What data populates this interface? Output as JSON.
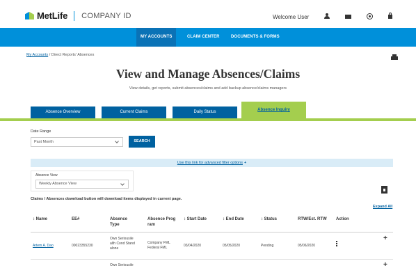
{
  "header": {
    "brand": "MetLife",
    "product": "COMPANY ID",
    "welcome": "Welcome User",
    "icons": [
      "user-icon",
      "mail-icon",
      "gear-icon",
      "lock-icon"
    ]
  },
  "nav": {
    "items": [
      {
        "label": "MY ACCOUNTS",
        "active": true
      },
      {
        "label": "CLAIM CENTER",
        "active": false
      },
      {
        "label": "DOCUMENTS & FORMS",
        "active": false
      }
    ]
  },
  "breadcrumb": {
    "root": "My Accounts",
    "rest": " / Direct Reports' Absences"
  },
  "page": {
    "title": "View and Manage Absences/Claims",
    "subtitle": "View details, get reports, submit absences/claims and add backup absence/claims managers"
  },
  "tabs": [
    {
      "label": "Absence Overview",
      "active": false
    },
    {
      "label": "Current Claims",
      "active": false
    },
    {
      "label": "Daily Status",
      "active": false
    },
    {
      "label": "Absence Inquiry",
      "active": true
    }
  ],
  "filters": {
    "date_range_label": "Date Range",
    "date_range_value": "Past Month",
    "search_label": "SEARCH",
    "advanced_link": "Use this link for advanced filter options",
    "advanced_plus": "+",
    "absence_view_label": "Absence View",
    "absence_view_value": "Weekly Absence View"
  },
  "notice": "Claims / Absences download button will download items displayed in current page.",
  "expand_all": "Expand All",
  "table": {
    "columns": [
      "↕ Name",
      "EE#",
      "Absence Type",
      "Absence Prog ram",
      "↕ Start Date",
      "↕ End Date",
      "↕ Status",
      "RTW/Est. RTW",
      "Action"
    ],
    "rows": [
      {
        "name": "Artem A. Dao",
        "ee": "00023355230",
        "type": "Own Seriousile alth Cond Stand alone",
        "program": "Company FML Federal FML",
        "start": "03/04/2020",
        "end": "05/05/2020",
        "status": "Pending",
        "rtw": "05/06/2020",
        "expand": "+"
      },
      {
        "name": "",
        "ee": "",
        "type": "Own Seriousile",
        "program": "",
        "start": "",
        "end": "",
        "status": "",
        "rtw": "",
        "expand": "+"
      }
    ]
  },
  "colors": {
    "primary_blue": "#0090da",
    "dark_blue": "#0061a0",
    "green": "#a4ce4e"
  }
}
